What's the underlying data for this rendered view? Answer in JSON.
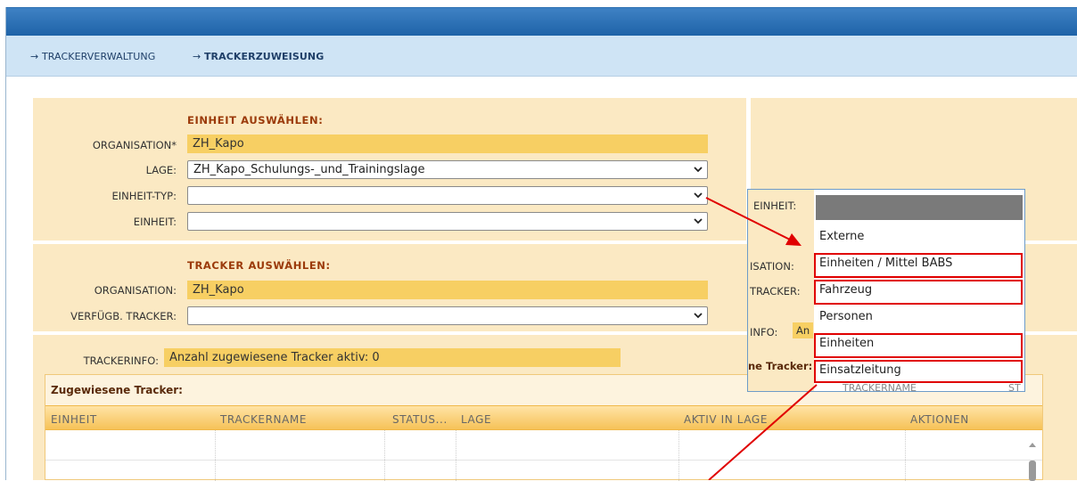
{
  "breadcrumb": {
    "items": [
      {
        "label": "TRACKERVERWALTUNG",
        "current": false
      },
      {
        "label": "TRACKERZUWEISUNG",
        "current": true
      }
    ],
    "separator": "→"
  },
  "einheit_section": {
    "title": "EINHEIT AUSWÄHLEN:",
    "organisation_label": "ORGANISATION*",
    "organisation_value": "ZH_Kapo",
    "lage_label": "LAGE:",
    "lage_value": "ZH_Kapo_Schulungs-_und_Trainingslage",
    "einheit_typ_label": "EINHEIT-TYP:",
    "einheit_typ_value": "",
    "einheit_label": "EINHEIT:",
    "einheit_value": ""
  },
  "tracker_section": {
    "title": "TRACKER AUSWÄHLEN:",
    "organisation_label": "ORGANISATION:",
    "organisation_value": "ZH_Kapo",
    "verfuegb_label": "VERFÜGB. TRACKER:",
    "verfuegb_value": ""
  },
  "trackerinfo": {
    "label": "TRACKERINFO:",
    "value": "Anzahl zugewiesene Tracker aktiv: 0"
  },
  "grid": {
    "title": "Zugewiesene Tracker:",
    "columns": [
      "EINHEIT",
      "TRACKERNAME",
      "STATUS...",
      "LAGE",
      "AKTIV IN LAGE",
      "AKTIONEN"
    ]
  },
  "zoom_panel": {
    "einheit_label": "EINHEIT:",
    "organisation_label_partial": "ISATION:",
    "tracker_label_partial": "TRACKER:",
    "info_label_partial": "INFO:",
    "info_value_partial": "An",
    "tracker_title_partial": "ne Tracker:",
    "grid_col_partial": "TRACKERNAME",
    "grid_col_partial2": "ST",
    "options": [
      {
        "label": "Externe",
        "highlighted": false
      },
      {
        "label": "Einheiten / Mittel BABS",
        "highlighted": true
      },
      {
        "label": "Fahrzeug",
        "highlighted": true
      },
      {
        "label": "Personen",
        "highlighted": false
      },
      {
        "label": "Einheiten",
        "highlighted": true
      },
      {
        "label": "Einsatzleitung",
        "highlighted": true
      }
    ]
  },
  "colors": {
    "topbar": "#1e63a8",
    "crumbbar": "#cfe4f5",
    "panel": "#fbe9c3",
    "filled_field": "#f7cf63",
    "section_title": "#9b3a0a",
    "highlight": "#e00000"
  }
}
